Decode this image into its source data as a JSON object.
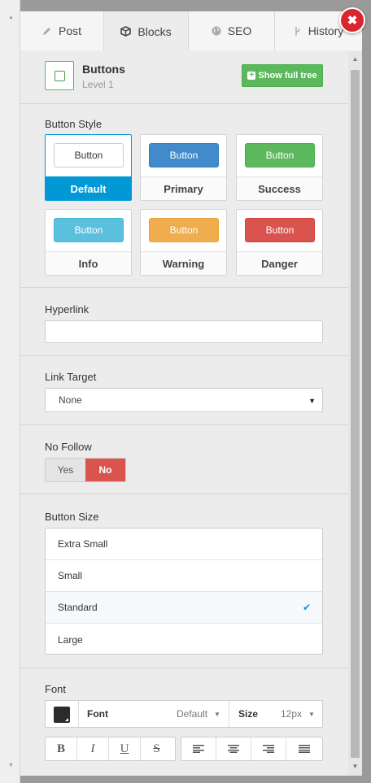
{
  "tabs": [
    {
      "label": "Post",
      "icon": "pencil-icon"
    },
    {
      "label": "Blocks",
      "icon": "cube-icon"
    },
    {
      "label": "SEO",
      "icon": "globe-icon"
    },
    {
      "label": "History",
      "icon": "branch-icon"
    }
  ],
  "active_tab": "Blocks",
  "header": {
    "title": "Buttons",
    "subtitle": "Level 1",
    "show_tree_label": "Show full tree"
  },
  "button_style": {
    "label": "Button Style",
    "preview_text": "Button",
    "selected": "Default",
    "options": [
      {
        "name": "Default",
        "bg": "#ffffff",
        "fg": "#333333",
        "border": "#cccccc"
      },
      {
        "name": "Primary",
        "bg": "#428bca",
        "fg": "#ffffff",
        "border": "#357ebd"
      },
      {
        "name": "Success",
        "bg": "#5cb85c",
        "fg": "#ffffff",
        "border": "#4cae4c"
      },
      {
        "name": "Info",
        "bg": "#5bc0de",
        "fg": "#ffffff",
        "border": "#46b8da"
      },
      {
        "name": "Warning",
        "bg": "#f0ad4e",
        "fg": "#ffffff",
        "border": "#eea236"
      },
      {
        "name": "Danger",
        "bg": "#d9534f",
        "fg": "#ffffff",
        "border": "#d43f3a"
      }
    ]
  },
  "hyperlink": {
    "label": "Hyperlink",
    "value": ""
  },
  "link_target": {
    "label": "Link Target",
    "value": "None"
  },
  "no_follow": {
    "label": "No Follow",
    "yes_label": "Yes",
    "no_label": "No",
    "value": "No"
  },
  "button_size": {
    "label": "Button Size",
    "options": [
      "Extra Small",
      "Small",
      "Standard",
      "Large"
    ],
    "selected": "Standard"
  },
  "font": {
    "label": "Font",
    "color": "#2b2b2b",
    "font_label": "Font",
    "font_value": "Default",
    "size_label": "Size",
    "size_value": "12px",
    "format_buttons": [
      {
        "glyph": "B",
        "name": "bold-button"
      },
      {
        "glyph": "I",
        "name": "italic-button"
      },
      {
        "glyph": "U",
        "name": "underline-button"
      },
      {
        "glyph": "S",
        "name": "strikethrough-button"
      }
    ],
    "align_buttons": [
      "align-left",
      "align-center",
      "align-right",
      "align-justify"
    ]
  },
  "colors": {
    "accent": "#0099d6",
    "close": "#d9262c"
  }
}
